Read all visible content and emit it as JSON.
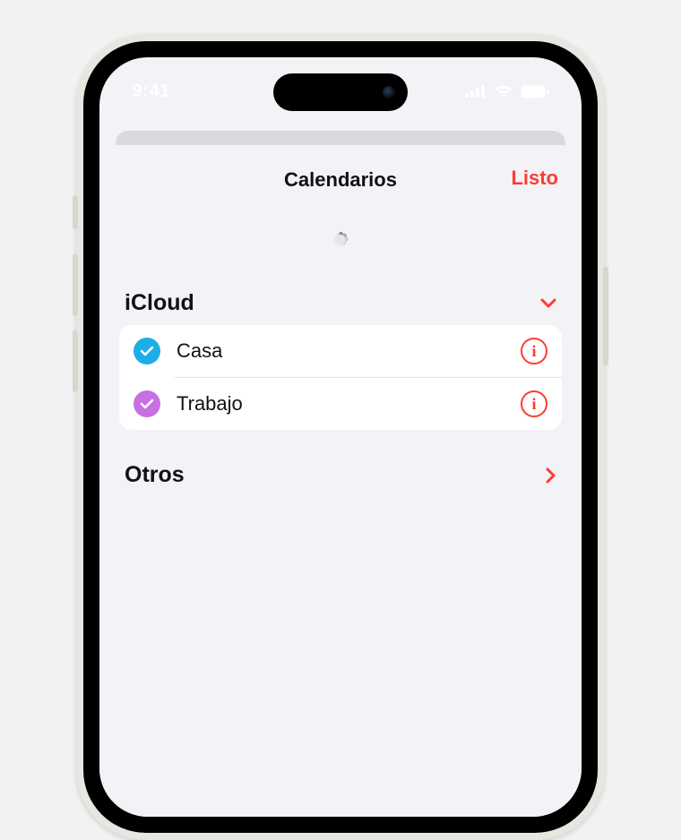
{
  "status": {
    "time": "9:41"
  },
  "sheet": {
    "title": "Calendarios",
    "done": "Listo"
  },
  "sections": {
    "icloud": {
      "title": "iCloud",
      "items": [
        {
          "label": "Casa",
          "color": "#1daee8"
        },
        {
          "label": "Trabajo",
          "color": "#c76fe3"
        }
      ]
    },
    "others": {
      "title": "Otros"
    }
  },
  "colors": {
    "accent": "#ff3b30"
  }
}
